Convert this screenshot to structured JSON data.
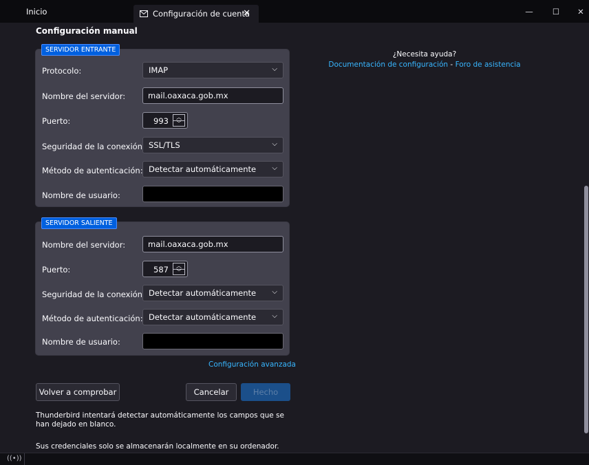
{
  "tabs": {
    "home_label": "Inicio",
    "active_label": "Configuración de cuenta",
    "close_glyph": "✕"
  },
  "window_controls": {
    "minimize": "—",
    "maximize": "☐",
    "close": "✕"
  },
  "page": {
    "section_title": "Configuración manual",
    "incoming": {
      "label": "SERVIDOR ENTRANTE",
      "protocol_label": "Protocolo:",
      "protocol_value": "IMAP",
      "server_label": "Nombre del servidor:",
      "server_value": "mail.oaxaca.gob.mx",
      "port_label": "Puerto:",
      "port_value": "993",
      "security_label": "Seguridad de la conexión:",
      "security_value": "SSL/TLS",
      "auth_label": "Método de autenticación:",
      "auth_value": "Detectar automáticamente",
      "username_label": "Nombre de usuario:",
      "username_value": ""
    },
    "outgoing": {
      "label": "SERVIDOR SALIENTE",
      "server_label": "Nombre del servidor:",
      "server_value": "mail.oaxaca.gob.mx",
      "port_label": "Puerto:",
      "port_value": "587",
      "security_label": "Seguridad de la conexión:",
      "security_value": "Detectar automáticamente",
      "auth_label": "Método de autenticación:",
      "auth_value": "Detectar automáticamente",
      "username_label": "Nombre de usuario:",
      "username_value": ""
    },
    "advanced_link": "Configuración avanzada",
    "buttons": {
      "retest": "Volver a comprobar",
      "cancel": "Cancelar",
      "done": "Hecho"
    },
    "info_autodetect": "Thunderbird intentará detectar automáticamente los campos que se han dejado en blanco.",
    "info_credentials": "Sus credenciales solo se almacenarán localmente en su ordenador."
  },
  "help": {
    "question": "¿Necesita ayuda?",
    "docs_link": "Documentación de configuración",
    "separator": " - ",
    "forum_link": "Foro de asistencia"
  },
  "icons": {
    "chevron": "⌵",
    "spin_up": "︿",
    "spin_down": "﹀",
    "status": "((•))"
  },
  "colors": {
    "accent": "#0060df",
    "link": "#38b6ff",
    "background": "#1c1b22",
    "panel": "#42414d"
  }
}
